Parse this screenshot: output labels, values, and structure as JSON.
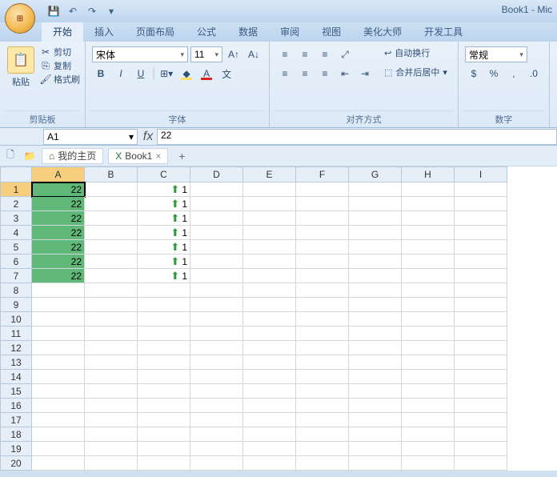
{
  "title": "Book1 - Mic",
  "ribbon": {
    "tabs": [
      "开始",
      "插入",
      "页面布局",
      "公式",
      "数据",
      "审阅",
      "视图",
      "美化大师",
      "开发工具"
    ],
    "active_tab": "开始",
    "clipboard": {
      "cut": "剪切",
      "copy": "复制",
      "format_painter": "格式刷",
      "paste": "粘贴",
      "label": "剪贴板"
    },
    "font": {
      "name": "宋体",
      "size": "11",
      "label": "字体"
    },
    "alignment": {
      "wrap": "自动换行",
      "merge": "合并后居中",
      "label": "对齐方式"
    },
    "number": {
      "format": "常规",
      "label": "数字"
    }
  },
  "formula_bar": {
    "name_box": "A1",
    "fx": "fx",
    "value": "22"
  },
  "doc_tabs": {
    "home": "我的主页",
    "book": "Book1"
  },
  "columns": [
    "A",
    "B",
    "C",
    "D",
    "E",
    "F",
    "G",
    "H",
    "I"
  ],
  "rows_visible": 20,
  "data": {
    "A": [
      "22",
      "22",
      "22",
      "22",
      "22",
      "22",
      "22"
    ],
    "C": [
      "1",
      "1",
      "1",
      "1",
      "1",
      "1",
      "1"
    ]
  },
  "selected_cell": "A1",
  "chart_data": {
    "type": "table",
    "columns": [
      "A",
      "C"
    ],
    "rows": [
      {
        "A": 22,
        "C": 1
      },
      {
        "A": 22,
        "C": 1
      },
      {
        "A": 22,
        "C": 1
      },
      {
        "A": 22,
        "C": 1
      },
      {
        "A": 22,
        "C": 1
      },
      {
        "A": 22,
        "C": 1
      },
      {
        "A": 22,
        "C": 1
      }
    ],
    "notes": "Column C has green up-arrow icon set (conditional formatting)"
  }
}
